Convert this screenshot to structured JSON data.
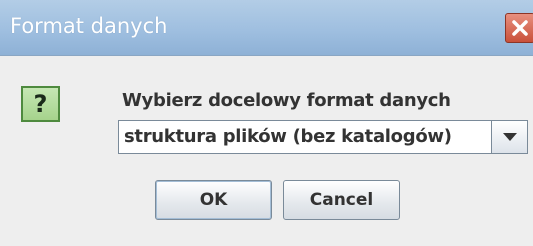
{
  "dialog": {
    "title": "Format danych",
    "message": "Wybierz docelowy format danych",
    "selected_format": "struktura plików (bez katalogów)",
    "ok_label": "OK",
    "cancel_label": "Cancel",
    "question_glyph": "?"
  },
  "icons": {
    "close": "close-icon",
    "question": "question-icon",
    "dropdown": "chevron-down-icon"
  },
  "colors": {
    "titlebar": "#9fbfe0",
    "close_button": "#c9503a",
    "question_icon_bg": "#a6d38c",
    "question_icon_border": "#4e8a3e",
    "window_bg": "#eeeeee"
  }
}
